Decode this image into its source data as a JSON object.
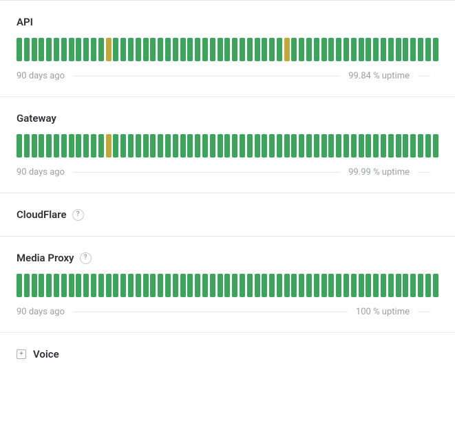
{
  "labels": {
    "days_ago": "90 days ago",
    "uptime_suffix": "% uptime",
    "help": "?",
    "expand": "+"
  },
  "components": [
    {
      "id": "api",
      "name": "API",
      "has_graph": true,
      "has_help": false,
      "uptime": "99.84",
      "bars": [
        "green",
        "green",
        "green",
        "green",
        "green",
        "green",
        "green",
        "green",
        "green",
        "green",
        "green",
        "green",
        "yellow",
        "green",
        "green",
        "green",
        "green",
        "green",
        "green",
        "green",
        "green",
        "green",
        "green",
        "green",
        "green",
        "green",
        "green",
        "green",
        "green",
        "green",
        "green",
        "green",
        "green",
        "green",
        "green",
        "green",
        "yellow",
        "green",
        "green",
        "green",
        "green",
        "green",
        "green",
        "green",
        "green",
        "green",
        "green",
        "green",
        "green",
        "green",
        "green",
        "green",
        "green",
        "green",
        "green",
        "green",
        "green",
        "green",
        "green"
      ]
    },
    {
      "id": "gateway",
      "name": "Gateway",
      "has_graph": true,
      "has_help": false,
      "uptime": "99.99",
      "bars": [
        "green",
        "green",
        "green",
        "green",
        "green",
        "green",
        "green",
        "green",
        "green",
        "green",
        "green",
        "green",
        "yellow",
        "green",
        "green",
        "green",
        "green",
        "green",
        "green",
        "green",
        "green",
        "green",
        "green",
        "green",
        "green",
        "green",
        "green",
        "green",
        "green",
        "green",
        "green",
        "green",
        "green",
        "green",
        "green",
        "green",
        "green",
        "green",
        "green",
        "green",
        "green",
        "green",
        "green",
        "green",
        "green",
        "green",
        "green",
        "green",
        "green",
        "green",
        "green",
        "green",
        "green",
        "green",
        "green",
        "green",
        "green",
        "green",
        "green"
      ]
    },
    {
      "id": "cloudflare",
      "name": "CloudFlare",
      "has_graph": false,
      "has_help": true
    },
    {
      "id": "mediaproxy",
      "name": "Media Proxy",
      "has_graph": true,
      "has_help": true,
      "uptime": "100",
      "bars": [
        "green",
        "green",
        "green",
        "green",
        "green",
        "green",
        "green",
        "green",
        "green",
        "green",
        "green",
        "green",
        "green",
        "green",
        "green",
        "green",
        "green",
        "green",
        "green",
        "green",
        "green",
        "green",
        "green",
        "green",
        "green",
        "green",
        "green",
        "green",
        "green",
        "green",
        "green",
        "green",
        "green",
        "green",
        "green",
        "green",
        "green",
        "green",
        "green",
        "green",
        "green",
        "green",
        "green",
        "green",
        "green",
        "green",
        "green",
        "green",
        "green",
        "green",
        "green",
        "green",
        "green",
        "green",
        "green",
        "green",
        "green",
        "green",
        "green"
      ]
    }
  ],
  "voice": {
    "name": "Voice"
  }
}
